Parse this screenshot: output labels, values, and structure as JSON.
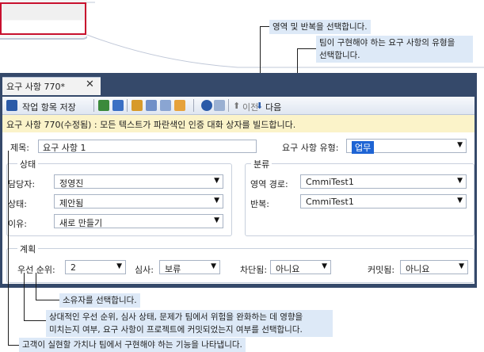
{
  "callouts": {
    "area_iteration": "영역 및 반복을 선택합니다.",
    "requirement_type_line1": "팀이 구현해야 하는 요구 사항의 유형을",
    "requirement_type_line2": "선택합니다.",
    "owner": "소유자를 선택합니다.",
    "factors_line1": "상대적인 우선 순위, 심사 상태, 문제가 팀에서 위험을 완화하는 데 영향을",
    "factors_line2": "미치는지 여부, 요구 사항이 프로젝트에 커밋되었는지 여부를 선택합니다.",
    "title": "고객이 실현할 가치나 팀에서 구현해야 하는 기능을 나타냅니다."
  },
  "tab": {
    "label": "요구 사항 770*",
    "close": "✕"
  },
  "toolbar": {
    "save_label": "작업 항목 저장",
    "previous_label": "이전",
    "next_label": "다음"
  },
  "info_bar": "요구 사항 770(수정됨) : 모든 텍스트가 파란색인 인증 대화 상자를 빌드합니다.",
  "form": {
    "title_label": "제목:",
    "title_value": "요구 사항 1",
    "type_label": "요구 사항 유형:",
    "type_value": "업무",
    "status_group": "상태",
    "assigned_label": "담당자:",
    "assigned_value": "정영진",
    "state_label": "상태:",
    "state_value": "제안됨",
    "reason_label": "이유:",
    "reason_value": "새로 만들기",
    "classification_group": "분류",
    "area_label": "영역 경로:",
    "area_value": "CmmiTest1",
    "iteration_label": "반복:",
    "iteration_value": "CmmiTest1",
    "planning_group": "계획",
    "priority_label": "우선 순위:",
    "priority_value": "2",
    "triage_label": "심사:",
    "triage_value": "보류",
    "blocked_label": "차단됨:",
    "blocked_value": "아니요",
    "committed_label": "커밋됨:",
    "committed_value": "아니요"
  },
  "colors": {
    "window_frame": "#35496a",
    "callout_bg": "#dde9f7",
    "info_bar_bg": "#fbf3c9",
    "selection": "#1e64d4",
    "thumbnail_highlight": "#c8102e"
  }
}
